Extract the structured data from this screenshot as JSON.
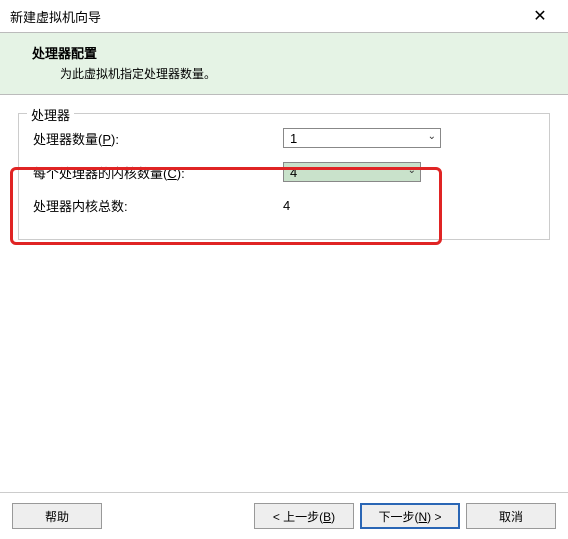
{
  "window": {
    "title": "新建虚拟机向导"
  },
  "header": {
    "title": "处理器配置",
    "subtitle": "为此虚拟机指定处理器数量。"
  },
  "fieldset": {
    "legend": "处理器",
    "processors": {
      "label": "处理器数量(",
      "accel": "P",
      "label_end": "):",
      "value": "1"
    },
    "cores": {
      "label": "每个处理器的内核数量(",
      "accel": "C",
      "label_end": "):",
      "value": "4"
    },
    "total": {
      "label": "处理器内核总数:",
      "value": "4"
    }
  },
  "footer": {
    "help": "帮助",
    "back": {
      "pre": "< 上一步(",
      "accel": "B",
      "post": ")"
    },
    "next": {
      "pre": "下一步(",
      "accel": "N",
      "post": ") >"
    },
    "cancel": "取消"
  }
}
